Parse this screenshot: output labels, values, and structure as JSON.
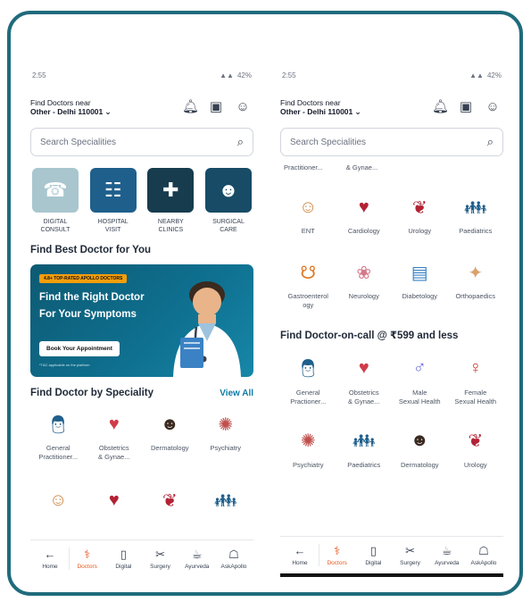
{
  "status": {
    "time": "2:55",
    "battery": "42%"
  },
  "location": {
    "label": "Find Doctors near",
    "value": "Other - Delhi 110001"
  },
  "search": {
    "placeholder": "Search Specialities"
  },
  "quick_categories": [
    {
      "label_line1": "DIGITAL",
      "label_line2": "CONSULT",
      "color": "#a9c6cf",
      "icon": "stethoscope-phone-icon"
    },
    {
      "label_line1": "HOSPITAL",
      "label_line2": "VISIT",
      "color": "#1f5f8c",
      "icon": "hospital-icon"
    },
    {
      "label_line1": "NEARBY",
      "label_line2": "CLINICS",
      "color": "#173c4e",
      "icon": "map-pin-icon"
    },
    {
      "label_line1": "SURGICAL",
      "label_line2": "CARE",
      "color": "#174b66",
      "icon": "surgeon-icon"
    }
  ],
  "best_doctor": {
    "title": "Find Best Doctor for You"
  },
  "banner": {
    "tag": "4.8+ TOP-RATED APOLLO DOCTORS",
    "headline_line1": "Find the Right Doctor",
    "headline_line2": "For Your Symptoms",
    "cta": "Book Your Appointment",
    "fine_print": "*T&C applicable on the platform"
  },
  "speciality_section": {
    "title": "Find Doctor by Speciality",
    "view_all": "View All"
  },
  "left_specialities": [
    {
      "line1": "General",
      "line2": "Practitioner...",
      "icon": "doctor-icon"
    },
    {
      "line1": "Obstetrics",
      "line2": "& Gynae...",
      "icon": "uterus-icon"
    },
    {
      "line1": "Dermatology",
      "line2": "",
      "icon": "skin-face-icon"
    },
    {
      "line1": "Psychiatry",
      "line2": "",
      "icon": "brain-head-icon"
    }
  ],
  "right_top_partial": {
    "left": "Practitioner...",
    "right": "& Gynae..."
  },
  "right_specialities": [
    {
      "line1": "ENT",
      "line2": "",
      "icon": "ear-head-icon"
    },
    {
      "line1": "Cardiology",
      "line2": "",
      "icon": "heart-icon"
    },
    {
      "line1": "Urology",
      "line2": "",
      "icon": "kidney-icon"
    },
    {
      "line1": "Paediatrics",
      "line2": "",
      "icon": "child-doctor-icon"
    },
    {
      "line1": "Gastroenterol",
      "line2": "ogy",
      "icon": "stomach-icon"
    },
    {
      "line1": "Neurology",
      "line2": "",
      "icon": "brain-icon"
    },
    {
      "line1": "Diabetology",
      "line2": "",
      "icon": "glucose-meter-icon"
    },
    {
      "line1": "Orthopaedics",
      "line2": "",
      "icon": "bone-joint-icon"
    }
  ],
  "on_call": {
    "title": "Find Doctor-on-call @ ₹599 and less"
  },
  "on_call_specialities": [
    {
      "line1": "General",
      "line2": "Practioner...",
      "icon": "doctor-icon"
    },
    {
      "line1": "Obstetrics",
      "line2": "& Gynae...",
      "icon": "uterus-icon"
    },
    {
      "line1": "Male",
      "line2": "Sexual Health",
      "icon": "male-health-icon"
    },
    {
      "line1": "Female",
      "line2": "Sexual Health",
      "icon": "female-health-icon"
    },
    {
      "line1": "Psychiatry",
      "line2": "",
      "icon": "brain-head-icon"
    },
    {
      "line1": "Paediatrics",
      "line2": "",
      "icon": "child-doctor-icon"
    },
    {
      "line1": "Dermatology",
      "line2": "",
      "icon": "skin-face-icon"
    },
    {
      "line1": "Urology",
      "line2": "",
      "icon": "kidney-icon"
    }
  ],
  "nav_left": [
    "Home",
    "Doctors",
    "Digital",
    "Surgery",
    "Ayurveda",
    "AskApollo"
  ],
  "nav_right": [
    "Home",
    "Doctors",
    "Digital",
    "Surgery",
    "Ayurveda",
    "AskApollo"
  ],
  "colors": {
    "frame": "#1f6b7c",
    "accent": "#e8571e",
    "link": "#0e7ca6",
    "banner": "#0f7191"
  }
}
